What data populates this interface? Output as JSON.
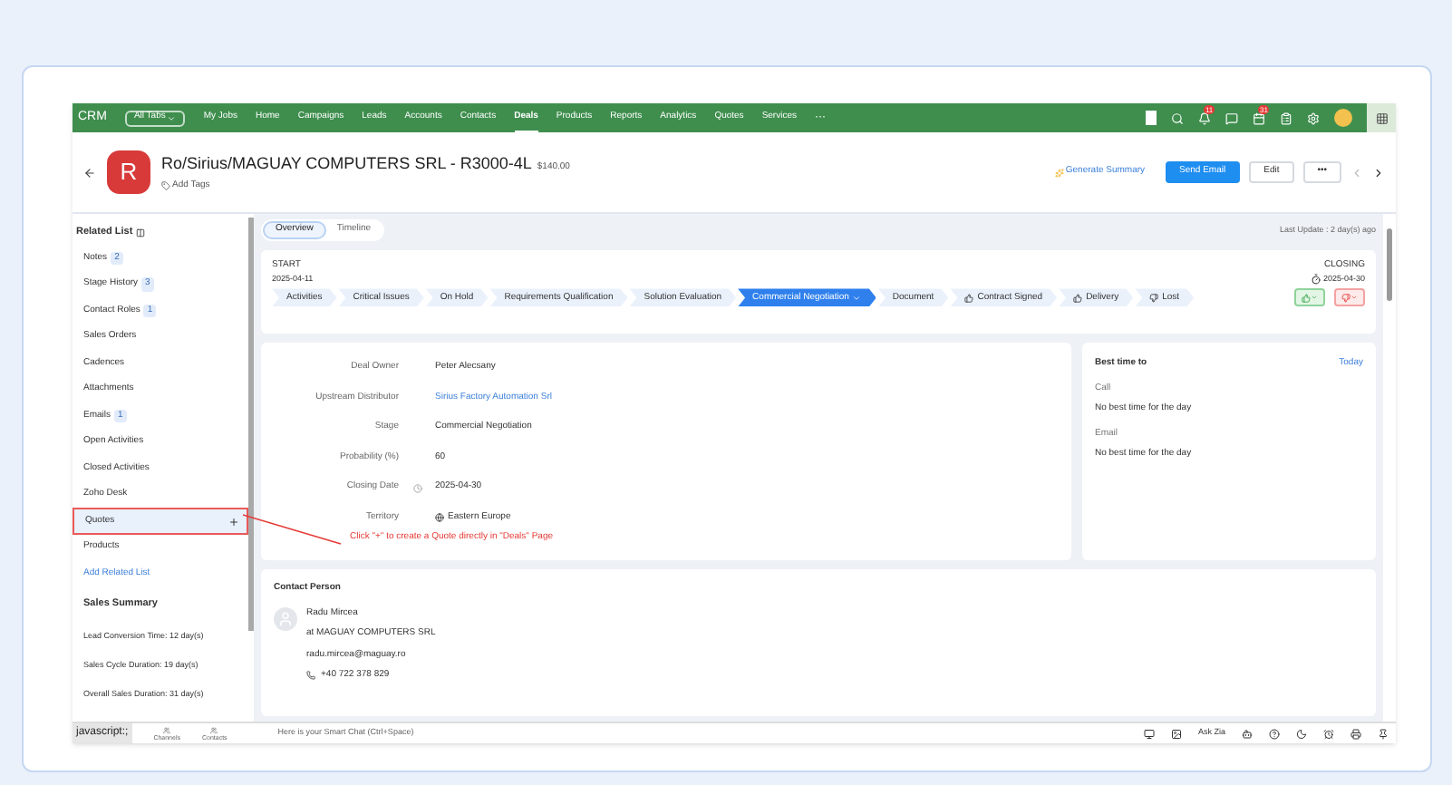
{
  "nav": {
    "logo": "CRM",
    "tabs_button": "All Tabs",
    "items": [
      {
        "label": "My Jobs",
        "selected": false
      },
      {
        "label": "Home",
        "selected": false
      },
      {
        "label": "Campaigns",
        "selected": false
      },
      {
        "label": "Leads",
        "selected": false
      },
      {
        "label": "Accounts",
        "selected": false
      },
      {
        "label": "Contacts",
        "selected": false
      },
      {
        "label": "Deals",
        "selected": true
      },
      {
        "label": "Products",
        "selected": false
      },
      {
        "label": "Reports",
        "selected": false
      },
      {
        "label": "Analytics",
        "selected": false
      },
      {
        "label": "Quotes",
        "selected": false
      },
      {
        "label": "Services",
        "selected": false
      }
    ],
    "more": "···",
    "badges": [
      "11",
      "31"
    ]
  },
  "header": {
    "avatar": "R",
    "title": "Ro/Sirius/MAGUAY COMPUTERS SRL - R3000-4L",
    "amount": "$140.00",
    "add_tags": "Add Tags",
    "summary": "Generate Summary",
    "buttons": [
      {
        "label": "Send Email",
        "kind": "primary"
      },
      {
        "label": "Edit",
        "kind": "secondary"
      },
      {
        "label": "•••",
        "kind": "secondary"
      }
    ]
  },
  "sidebar": {
    "title": "Related List",
    "items": [
      {
        "label": "Notes",
        "count": "2",
        "selected": false
      },
      {
        "label": "Stage History",
        "count": "3",
        "selected": false
      },
      {
        "label": "Contact Roles",
        "count": "1",
        "selected": false
      },
      {
        "label": "Sales Orders",
        "selected": false
      },
      {
        "label": "Cadences",
        "selected": false
      },
      {
        "label": "Attachments",
        "selected": false
      },
      {
        "label": "Emails",
        "count": "1",
        "selected": false
      },
      {
        "label": "Open Activities",
        "selected": false
      },
      {
        "label": "Closed Activities",
        "selected": false
      },
      {
        "label": "Zoho Desk",
        "selected": false
      },
      {
        "label": "Quotes",
        "selected": true
      },
      {
        "label": "Products",
        "selected": false
      }
    ],
    "add_link": "Add Related List",
    "summary_title": "Sales Summary",
    "summary": [
      "Lead Conversion Time: 12 day(s)",
      "Sales Cycle Duration: 19 day(s)",
      "Overall Sales Duration: 31 day(s)"
    ]
  },
  "tabs": [
    {
      "label": "Overview",
      "selected": true
    },
    {
      "label": "Timeline",
      "selected": false
    }
  ],
  "last_update": "Last Update : 2 day(s) ago",
  "stages": {
    "start_label": "START",
    "start_date": "2025-04-11",
    "end_label": "CLOSING",
    "end_date": "2025-04-30",
    "items": [
      {
        "label": "Activities",
        "kind": "plain",
        "selected": false
      },
      {
        "label": "Critical Issues",
        "kind": "plain",
        "selected": false
      },
      {
        "label": "On Hold",
        "kind": "plain",
        "selected": false
      },
      {
        "label": "Requirements Qualification",
        "kind": "plain",
        "selected": false
      },
      {
        "label": "Solution Evaluation",
        "kind": "plain",
        "selected": false
      },
      {
        "label": "Commercial Negotiation",
        "kind": "plain",
        "selected": true
      },
      {
        "label": "Document",
        "kind": "plain",
        "selected": false
      },
      {
        "label": "Contract Signed",
        "kind": "won",
        "selected": false
      },
      {
        "label": "Delivery",
        "kind": "won",
        "selected": false
      },
      {
        "label": "Lost",
        "kind": "lost",
        "selected": false
      }
    ]
  },
  "fields": [
    {
      "label": "Deal Owner",
      "value": "Peter Alecsany",
      "kind": "text"
    },
    {
      "label": "Upstream Distributor",
      "value": "Sirius Factory Automation Srl",
      "kind": "link"
    },
    {
      "label": "Stage",
      "value": "Commercial Negotiation",
      "kind": "text"
    },
    {
      "label": "Probability (%)",
      "value": "60",
      "kind": "text"
    },
    {
      "label": "Closing Date",
      "value": "2025-04-30",
      "kind": "date"
    },
    {
      "label": "Territory",
      "value": "Eastern Europe",
      "kind": "territory"
    }
  ],
  "annotation": "Click \"+\" to create a Quote directly in \"Deals\" Page",
  "best_time": {
    "title": "Best time to",
    "link": "Today",
    "rows": [
      {
        "label": "Call",
        "value": "No best time for the day"
      },
      {
        "label": "Email",
        "value": "No best time for the day"
      }
    ]
  },
  "contact": {
    "title": "Contact Person",
    "name": "Radu Mircea",
    "company": "at MAGUAY COMPUTERS SRL",
    "email": "radu.mircea@maguay.ro",
    "phone": "+40 722 378 829"
  },
  "bottom": {
    "status": "javascript:;",
    "items": [
      "Channels",
      "Contacts"
    ],
    "chat": "Here is your Smart Chat (Ctrl+Space)",
    "ask": "Ask Zia"
  }
}
